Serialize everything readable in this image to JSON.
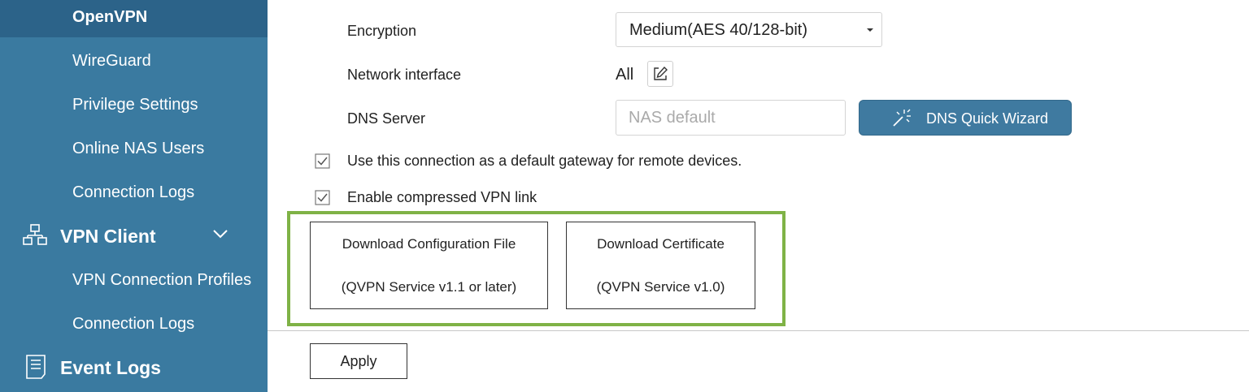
{
  "sidebar": {
    "items": [
      {
        "label": "OpenVPN",
        "active": true
      },
      {
        "label": "WireGuard"
      },
      {
        "label": "Privilege Settings"
      },
      {
        "label": "Online NAS Users"
      },
      {
        "label": "Connection Logs"
      }
    ],
    "vpn_client": {
      "label": "VPN Client",
      "icon": "network-icon",
      "expand_icon": "chevron-down-icon",
      "items": [
        {
          "label": "VPN Connection Profiles"
        },
        {
          "label": "Connection Logs"
        }
      ]
    },
    "event_logs": {
      "label": "Event Logs",
      "icon": "document-list-icon"
    }
  },
  "form": {
    "encryption": {
      "label": "Encryption",
      "value": "Medium(AES 40/128-bit)"
    },
    "network_interface": {
      "label": "Network interface",
      "value": "All",
      "edit_icon": "edit-icon"
    },
    "dns_server": {
      "label": "DNS Server",
      "placeholder": "NAS default",
      "value": ""
    },
    "dns_wizard": {
      "label": "DNS Quick Wizard",
      "icon": "magic-wand-icon"
    },
    "checkboxes": [
      {
        "label": "Use this connection as a default gateway for remote devices.",
        "checked": true
      },
      {
        "label": "Enable compressed VPN link",
        "checked": true
      }
    ],
    "downloads": [
      {
        "line1": "Download Configuration File",
        "line2": "(QVPN Service v1.1 or later)"
      },
      {
        "line1": "Download Certificate",
        "line2": "(QVPN Service v1.0)"
      }
    ],
    "apply": "Apply"
  },
  "colors": {
    "sidebar": "#3a7aa0",
    "sidebar_active": "#2c6389",
    "wizard_button": "#3f7aa0",
    "highlight_border": "#7fb246"
  }
}
